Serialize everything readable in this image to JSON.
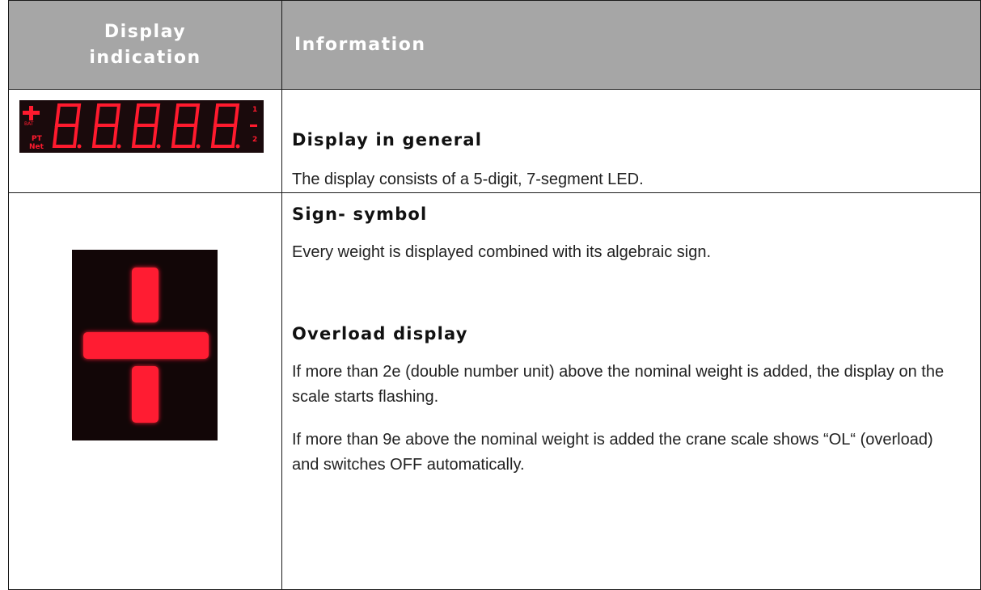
{
  "table": {
    "headers": [
      "Display\nindication",
      "Information"
    ],
    "header_col1_line1": "Display",
    "header_col1_line2": "indication",
    "header_col2": "Information"
  },
  "rows": [
    {
      "image": "seven-segment-led-display-88888",
      "led_labels": {
        "top_right": "1",
        "bottom_right": "2",
        "left_small": "PT",
        "left_net": "Net"
      },
      "sections": [
        {
          "heading": "Display in general",
          "paragraphs": [
            "The display consists of a 5-digit, 7-segment LED."
          ]
        }
      ]
    },
    {
      "image": "red-plus-sign-led",
      "sections": [
        {
          "heading": "Sign- symbol",
          "paragraphs": [
            "Every weight is displayed combined with its algebraic sign."
          ]
        },
        {
          "heading": "Overload display",
          "paragraphs": [
            "If more than 2e (double number unit) above the nominal weight is added, the display on the scale starts flashing.",
            "If more than 9e above the nominal weight is added the crane scale shows “OL“ (overload) and switches OFF automatically."
          ]
        }
      ]
    }
  ],
  "colors": {
    "header_bg": "#a6a6a6",
    "led_red": "#ff1a2e",
    "led_bg": "#1a0a0c"
  }
}
